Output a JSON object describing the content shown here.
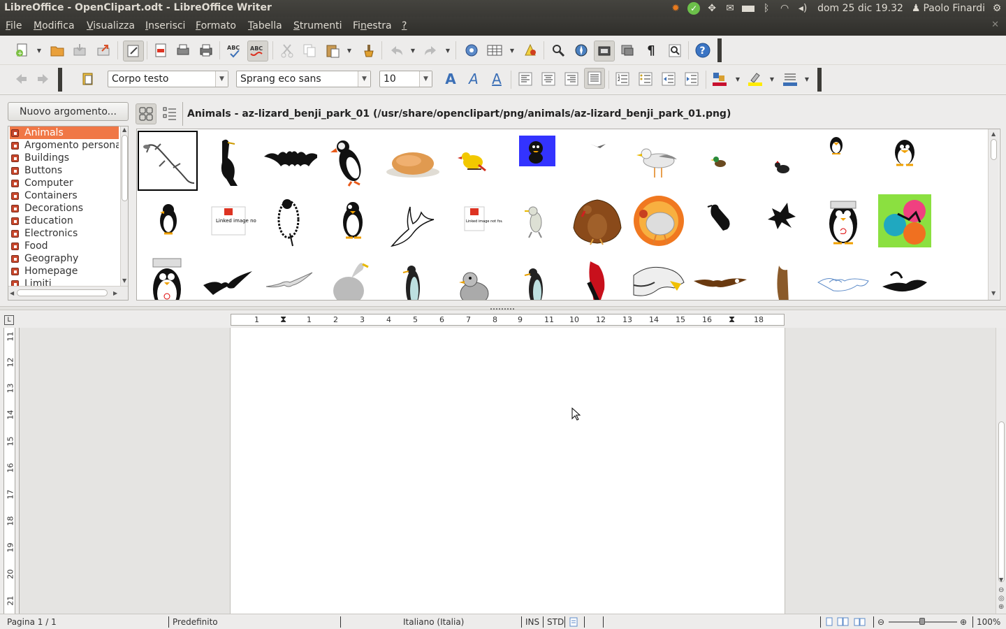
{
  "window": {
    "title": "LibreOffice - OpenClipart.odt - LibreOffice Writer"
  },
  "system": {
    "clock": "dom 25 dic 19.32",
    "user": "Paolo Finardi"
  },
  "menu": [
    {
      "label": "File",
      "mnemonic": "F",
      "rest": "ile"
    },
    {
      "label": "Modifica",
      "mnemonic": "M",
      "rest": "odifica"
    },
    {
      "label": "Visualizza",
      "mnemonic": "V",
      "rest": "isualizza"
    },
    {
      "label": "Inserisci",
      "mnemonic": "I",
      "rest": "nserisci"
    },
    {
      "label": "Formato",
      "mnemonic": "F",
      "rest": "ormato"
    },
    {
      "label": "Tabella",
      "mnemonic": "T",
      "rest": "abella"
    },
    {
      "label": "Strumenti",
      "mnemonic": "S",
      "rest": "trumenti"
    },
    {
      "label": "Finestra",
      "pre": "Fi",
      "mnemonic": "n",
      "rest": "estra"
    },
    {
      "label": "?",
      "mnemonic": "?",
      "rest": ""
    }
  ],
  "formatting": {
    "style": "Corpo testo",
    "font": "Sprang eco sans",
    "size": "10"
  },
  "gallery": {
    "new_topic_button": "Nuovo argomento...",
    "path": "Animals - az-lizard_benji_park_01 (/usr/share/openclipart/png/animals/az-lizard_benji_park_01.png)",
    "topics": [
      "Animals",
      "Argomento personale",
      "Buildings",
      "Buttons",
      "Computer",
      "Containers",
      "Decorations",
      "Education",
      "Electronics",
      "Food",
      "Geography",
      "Homepage",
      "Limiti"
    ],
    "selected_topic": "Animals",
    "image_not_found": "Linked image not found",
    "thumbnails": [
      [
        "lizard",
        "cormorant",
        "bat",
        "puffin",
        "roast-turkey",
        "yellow-bird",
        "penguin-blue",
        "flying-bird-small",
        "seagull",
        "duck-small",
        "hen-small",
        "penguin-small",
        "tux"
      ],
      [
        "penguin-cartoon",
        "image-not-found",
        "owl-sketch",
        "penguin",
        "dove",
        "image-not-found",
        "bird-dancing",
        "turkey",
        "turkey-colorful",
        "crow",
        "eagle-silhouette",
        "tux-debian",
        "flower-collage"
      ],
      [
        "tux-hat",
        "bird-flying",
        "seagull-flying",
        "goose",
        "king-penguin",
        "duck",
        "penguin-standing",
        "cardinal",
        "eagle-head",
        "eagle-flying",
        "bald-eagle",
        "swans",
        "swan-black"
      ]
    ]
  },
  "ruler": {
    "h_numbers": [
      "1",
      "1",
      "2",
      "3",
      "4",
      "5",
      "6",
      "7",
      "8",
      "9",
      "10",
      "11",
      "12",
      "13",
      "14",
      "15",
      "16",
      "17",
      "18"
    ],
    "v_numbers": [
      "11",
      "12",
      "13",
      "14",
      "15",
      "16",
      "17",
      "18",
      "19",
      "20",
      "21"
    ]
  },
  "status": {
    "page": "Pagina 1 / 1",
    "style": "Predefinito",
    "language": "Italiano (Italia)",
    "insert": "INS",
    "selection": "STD",
    "zoom": "100%"
  }
}
